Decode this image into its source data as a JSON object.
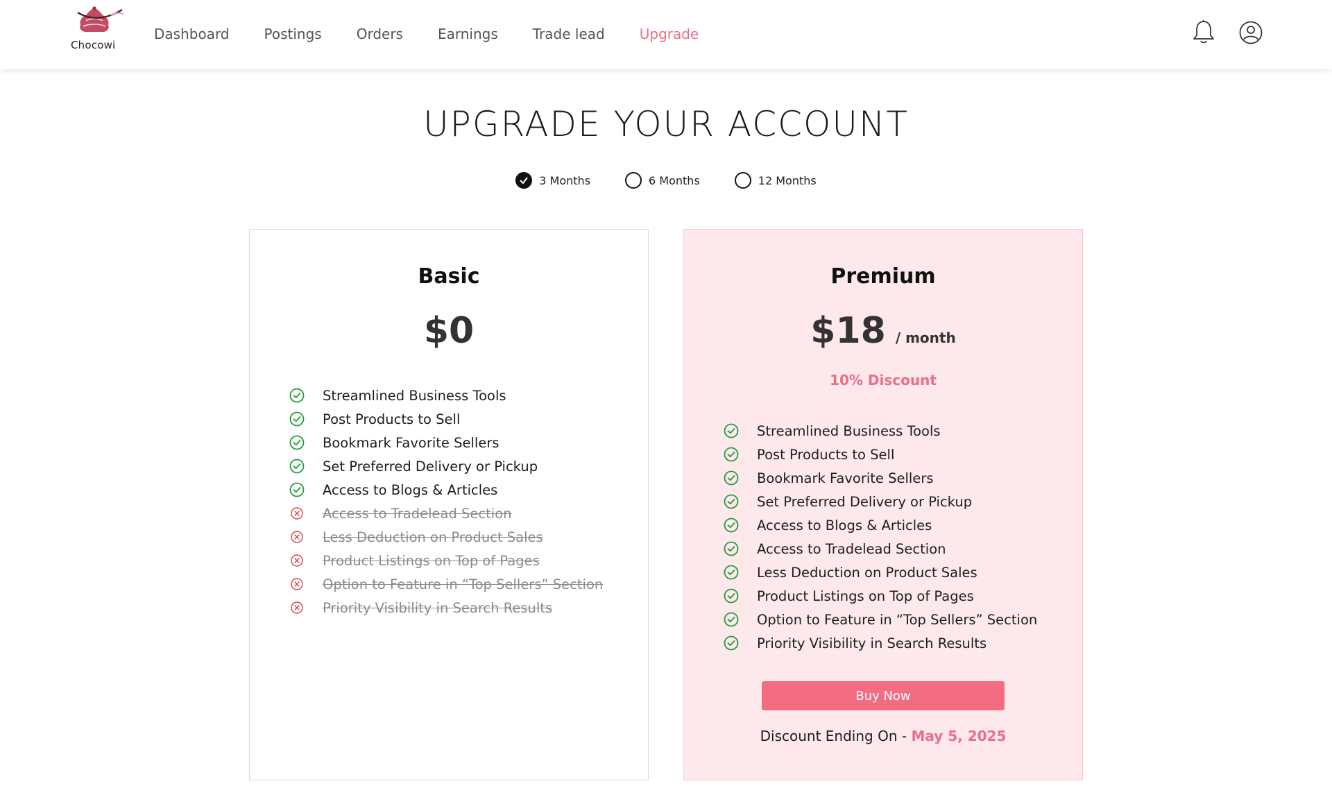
{
  "brand": {
    "name": "Chocowi"
  },
  "nav": {
    "items": [
      {
        "label": "Dashboard"
      },
      {
        "label": "Postings"
      },
      {
        "label": "Orders"
      },
      {
        "label": "Earnings"
      },
      {
        "label": "Trade lead"
      },
      {
        "label": "Upgrade"
      }
    ],
    "active": "Upgrade"
  },
  "header_icons": [
    "bell-icon",
    "user-circle-icon"
  ],
  "page": {
    "title": "UPGRADE YOUR ACCOUNT"
  },
  "periods": {
    "options": [
      {
        "label": "3 Months",
        "selected": true
      },
      {
        "label": "6 Months",
        "selected": false
      },
      {
        "label": "12 Months",
        "selected": false
      }
    ]
  },
  "plans": {
    "basic": {
      "name": "Basic",
      "price": "$0",
      "features": [
        {
          "label": "Streamlined Business Tools",
          "included": true
        },
        {
          "label": "Post Products to Sell",
          "included": true
        },
        {
          "label": "Bookmark Favorite Sellers",
          "included": true
        },
        {
          "label": "Set Preferred Delivery or Pickup",
          "included": true
        },
        {
          "label": "Access to Blogs & Articles",
          "included": true
        },
        {
          "label": "Access to Tradelead Section",
          "included": false
        },
        {
          "label": "Less Deduction on Product Sales",
          "included": false
        },
        {
          "label": "Product Listings on Top of Pages",
          "included": false
        },
        {
          "label": "Option to Feature in “Top Sellers” Section",
          "included": false
        },
        {
          "label": "Priority Visibility in Search Results",
          "included": false
        }
      ]
    },
    "premium": {
      "name": "Premium",
      "price": "$18",
      "period": "/ month",
      "discount": "10% Discount",
      "features": [
        {
          "label": "Streamlined Business Tools",
          "included": true
        },
        {
          "label": "Post Products to Sell",
          "included": true
        },
        {
          "label": "Bookmark Favorite Sellers",
          "included": true
        },
        {
          "label": "Set Preferred Delivery or Pickup",
          "included": true
        },
        {
          "label": "Access to Blogs & Articles",
          "included": true
        },
        {
          "label": "Access to Tradelead Section",
          "included": true
        },
        {
          "label": "Less Deduction on Product Sales",
          "included": true
        },
        {
          "label": "Product Listings on Top of Pages",
          "included": true
        },
        {
          "label": "Option to Feature in “Top Sellers” Section",
          "included": true
        },
        {
          "label": "Priority Visibility in Search Results",
          "included": true
        }
      ],
      "button_label": "Buy Now",
      "ending_label": "Discount Ending On - ",
      "ending_date": "May 5, 2025"
    }
  },
  "colors": {
    "accent": "#e8708a",
    "button": "#f26d82",
    "premium_bg": "#fde8ec",
    "check_green": "#1e9e3a",
    "cross_red": "#d64545"
  }
}
